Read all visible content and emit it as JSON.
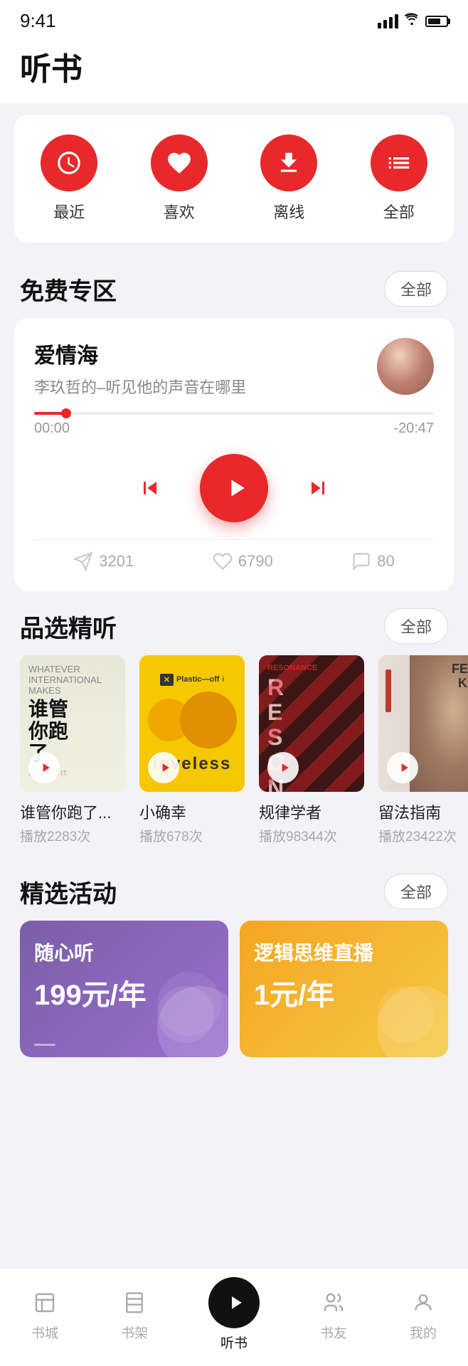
{
  "statusBar": {
    "time": "9:41"
  },
  "pageTitle": "听书",
  "quickActions": [
    {
      "id": "recent",
      "label": "最近",
      "icon": "clock"
    },
    {
      "id": "favorite",
      "label": "喜欢",
      "icon": "heart"
    },
    {
      "id": "offline",
      "label": "离线",
      "icon": "download"
    },
    {
      "id": "all",
      "label": "全部",
      "icon": "list"
    }
  ],
  "freeSection": {
    "title": "免费专区",
    "allLabel": "全部",
    "nowPlaying": {
      "title": "爱情海",
      "subtitle": "李玖哲的–听见他的声音在哪里",
      "timeStart": "00:00",
      "timeEnd": "-20:47",
      "progressPercent": 8,
      "stats": {
        "shares": "3201",
        "likes": "6790",
        "comments": "80"
      }
    }
  },
  "featuredSection": {
    "title": "品选精听",
    "allLabel": "全部",
    "items": [
      {
        "name": "谁管你跑了...",
        "plays": "播放2283次",
        "coverType": "1"
      },
      {
        "name": "小确幸",
        "plays": "播放678次",
        "coverType": "2"
      },
      {
        "name": "规律学者",
        "plays": "播放98344次",
        "coverType": "3"
      },
      {
        "name": "留法指南",
        "plays": "播放23422次",
        "coverType": "4"
      }
    ]
  },
  "activitiesSection": {
    "title": "精选活动",
    "allLabel": "全部",
    "items": [
      {
        "title": "随心听",
        "price": "199元/年",
        "theme": "purple"
      },
      {
        "title": "逻辑思维直播",
        "price": "1元/年",
        "theme": "yellow"
      }
    ]
  },
  "bottomNav": {
    "items": [
      {
        "id": "bookstore",
        "label": "书城",
        "active": false
      },
      {
        "id": "bookshelf",
        "label": "书架",
        "active": false
      },
      {
        "id": "audiobook",
        "label": "听书",
        "active": true
      },
      {
        "id": "friends",
        "label": "书友",
        "active": false
      },
      {
        "id": "mine",
        "label": "我的",
        "active": false
      }
    ]
  }
}
